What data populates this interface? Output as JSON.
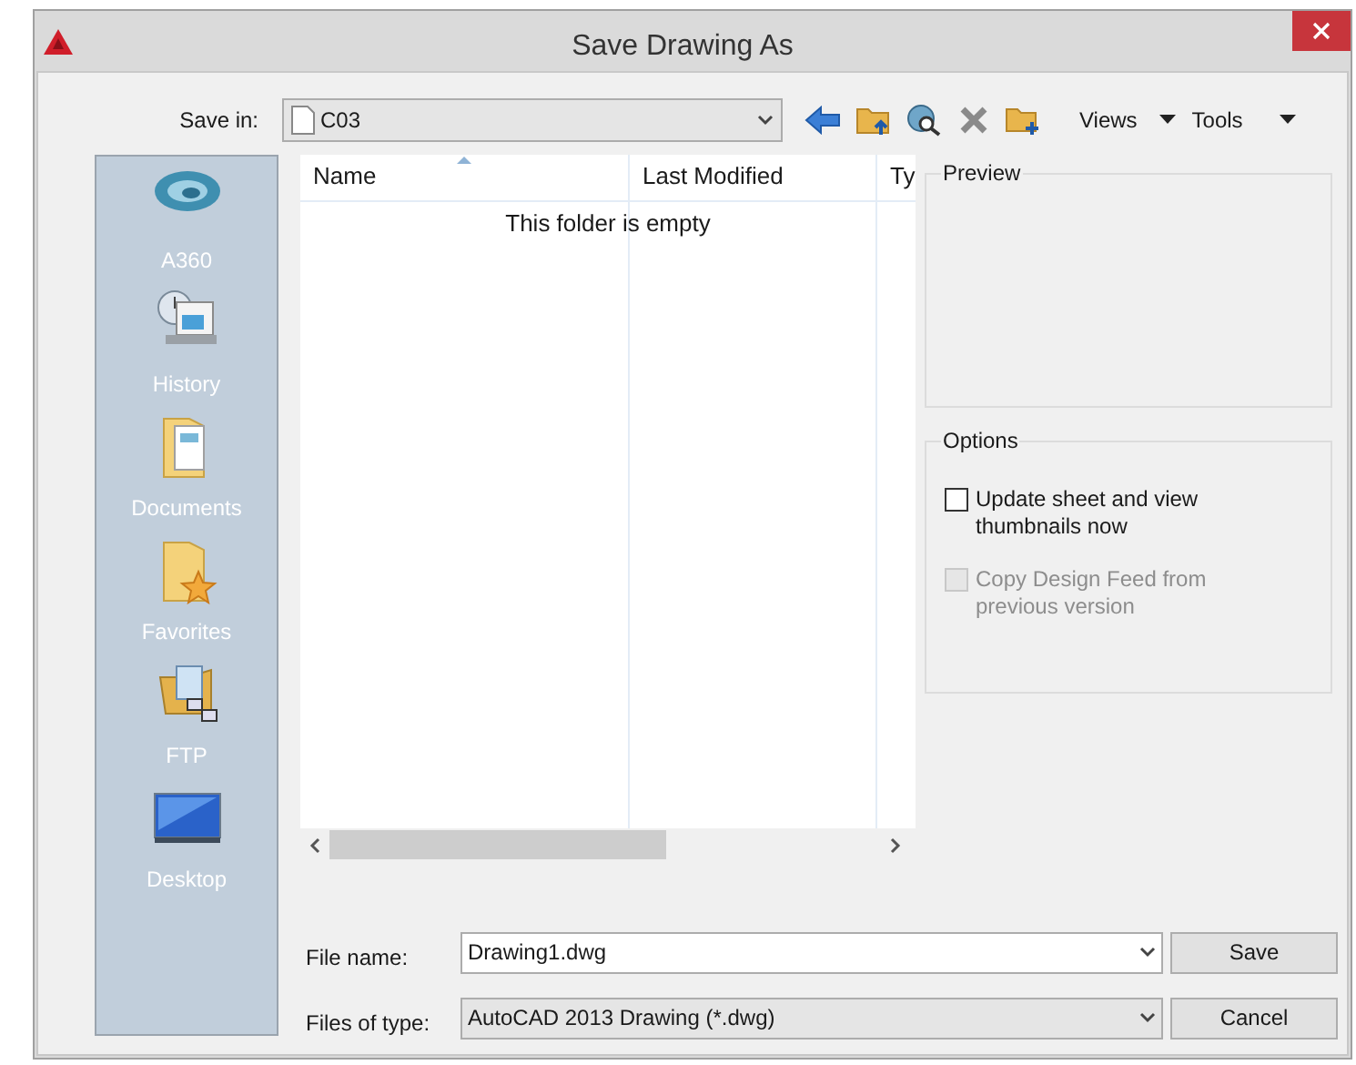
{
  "window": {
    "title": "Save Drawing As"
  },
  "save_in": {
    "label": "Save in:",
    "value": "C03"
  },
  "toolbar": {
    "views": "Views",
    "tools": "Tools"
  },
  "places": [
    {
      "label": "A360"
    },
    {
      "label": "History"
    },
    {
      "label": "Documents"
    },
    {
      "label": "Favorites"
    },
    {
      "label": "FTP"
    },
    {
      "label": "Desktop"
    }
  ],
  "file_list": {
    "columns": [
      {
        "label": "Name",
        "sorted": true
      },
      {
        "label": "Last Modified",
        "sorted": false
      },
      {
        "label": "Ty",
        "sorted": false
      }
    ],
    "empty_message": "This folder is empty"
  },
  "preview": {
    "title": "Preview"
  },
  "options": {
    "title": "Options",
    "items": [
      {
        "label": "Update sheet and view thumbnails now",
        "checked": false,
        "disabled": false
      },
      {
        "label": "Copy Design Feed from previous version",
        "checked": false,
        "disabled": true
      }
    ]
  },
  "file_name": {
    "label": "File name:",
    "value": "Drawing1.dwg"
  },
  "file_type": {
    "label": "Files of type:",
    "value": "AutoCAD 2013 Drawing (*.dwg)"
  },
  "buttons": [
    {
      "label": "Save"
    },
    {
      "label": "Cancel"
    }
  ]
}
